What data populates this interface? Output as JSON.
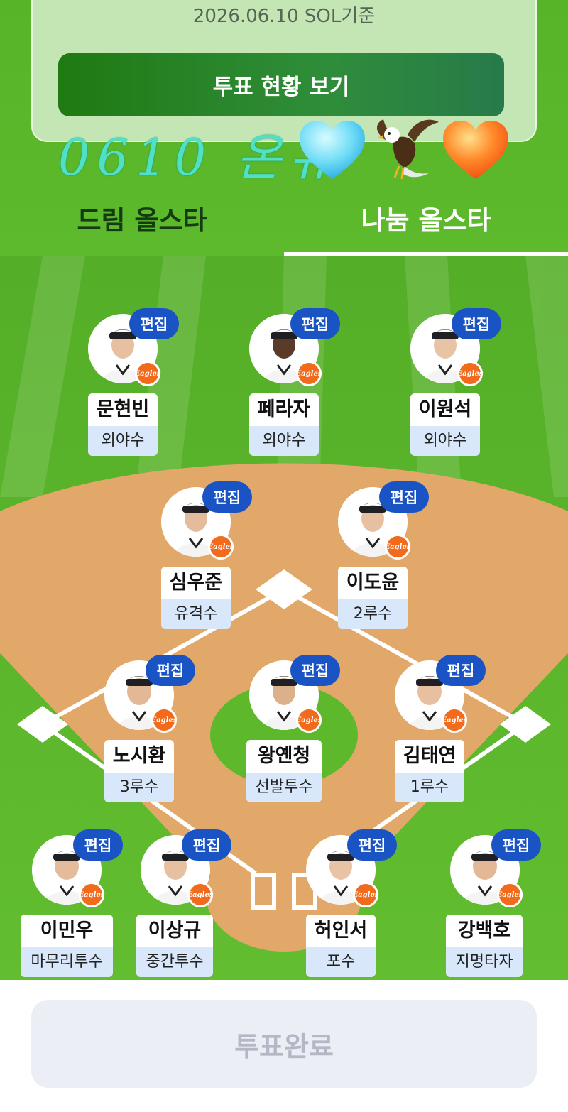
{
  "header": {
    "date_text": "2026.06.10 SOL기준",
    "vote_status_label": "투표 현황 보기"
  },
  "sticker": {
    "text": "0610 온유"
  },
  "tabs": [
    {
      "label": "드림 올스타",
      "active": false
    },
    {
      "label": "나눔 올스타",
      "active": true
    }
  ],
  "edit_label": "편집",
  "team_logo_text": "Eagles",
  "players": [
    {
      "name": "문현빈",
      "position": "외야수"
    },
    {
      "name": "페라자",
      "position": "외야수"
    },
    {
      "name": "이원석",
      "position": "외야수"
    },
    {
      "name": "심우준",
      "position": "유격수"
    },
    {
      "name": "이도윤",
      "position": "2루수"
    },
    {
      "name": "노시환",
      "position": "3루수"
    },
    {
      "name": "왕옌청",
      "position": "선발투수"
    },
    {
      "name": "김태연",
      "position": "1루수"
    },
    {
      "name": "이민우",
      "position": "마무리투수"
    },
    {
      "name": "이상규",
      "position": "중간투수"
    },
    {
      "name": "허인서",
      "position": "포수"
    },
    {
      "name": "강백호",
      "position": "지명타자"
    }
  ],
  "footer": {
    "vote_complete_label": "투표완료"
  },
  "colors": {
    "field_green": "#5fb92e",
    "infield_dirt": "#e2a86a",
    "edit_button": "#1a54c4",
    "vote_status_button": "#1f7a12",
    "team_badge": "#f26a1b"
  }
}
